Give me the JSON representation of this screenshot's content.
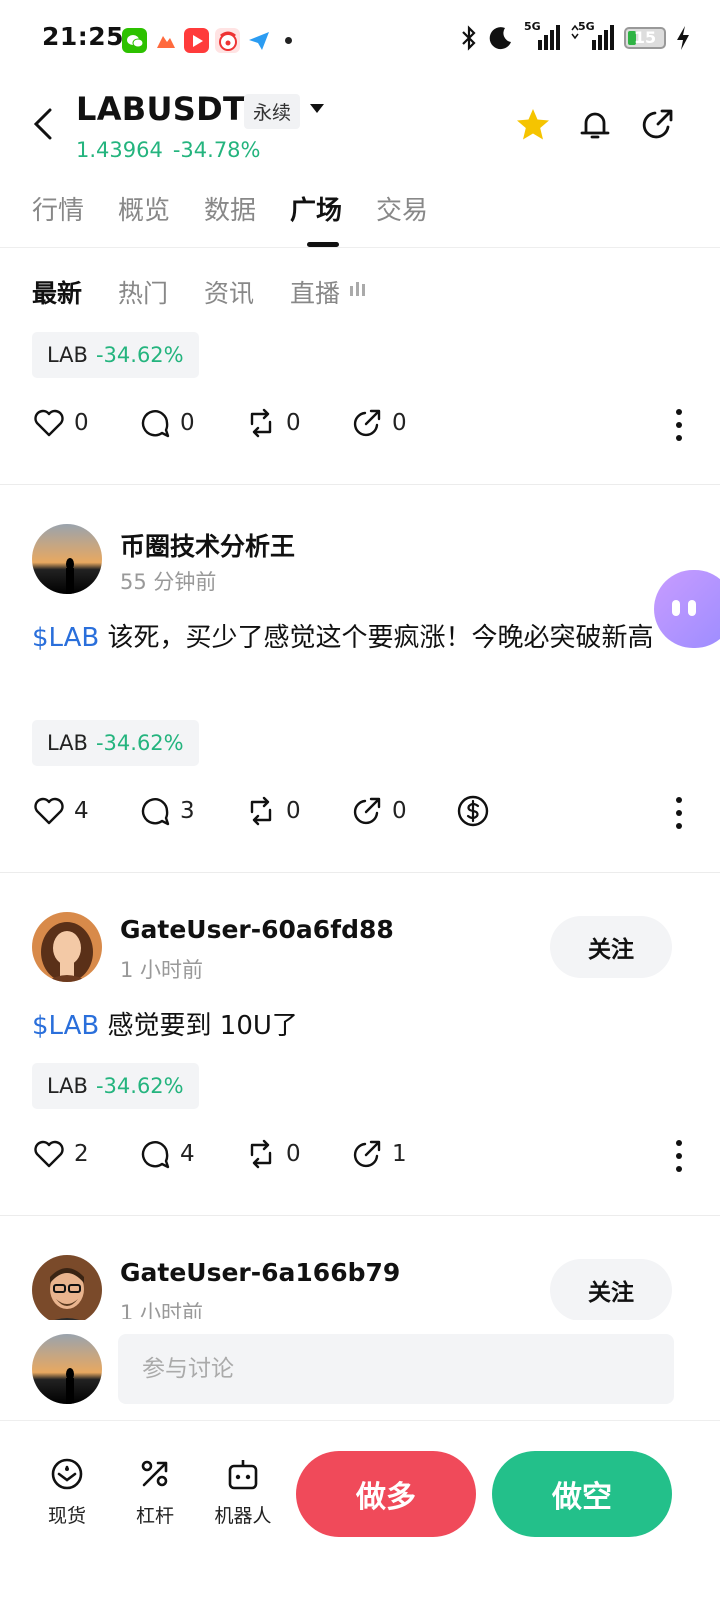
{
  "status_bar": {
    "time": "21:25",
    "battery": "15",
    "signal_1": "5G",
    "signal_2": "5G"
  },
  "header": {
    "pair": "LABUSDT",
    "contract_type": "永续",
    "price": "1.43964",
    "change": "-34.78%",
    "icons": [
      "back-arrow-icon",
      "star-icon",
      "bell-icon",
      "share-icon"
    ],
    "colors": {
      "up_green": "#24b47e",
      "star": "#f5c400"
    }
  },
  "tabs": [
    {
      "label": "行情"
    },
    {
      "label": "概览"
    },
    {
      "label": "数据"
    },
    {
      "label": "广场"
    },
    {
      "label": "交易"
    }
  ],
  "active_tab": "广场",
  "subtabs": [
    {
      "label": "最新"
    },
    {
      "label": "热门"
    },
    {
      "label": "资讯"
    },
    {
      "label": "直播"
    }
  ],
  "active_subtab": "最新",
  "posts": [
    {
      "tag": {
        "symbol": "LAB",
        "change": "-34.62%"
      },
      "likes": "0",
      "comments": "0",
      "reposts": "0",
      "shares": "0"
    },
    {
      "author": "币圈技术分析王",
      "time": "55 分钟前",
      "cashtag": "$LAB",
      "text": "该死，买少了感觉这个要疯涨！今晚必突破新高",
      "tag": {
        "symbol": "LAB",
        "change": "-34.62%"
      },
      "likes": "4",
      "comments": "3",
      "reposts": "0",
      "shares": "0",
      "tip_icon": "dollar-coin-icon"
    },
    {
      "author": "GateUser-60a6fd88",
      "time": "1 小时前",
      "follow_label": "关注",
      "cashtag": "$LAB",
      "text": "感觉要到 10U了",
      "tag": {
        "symbol": "LAB",
        "change": "-34.62%"
      },
      "likes": "2",
      "comments": "4",
      "reposts": "0",
      "shares": "1"
    },
    {
      "author": "GateUser-6a166b79",
      "time": "1 小时前",
      "follow_label": "关注"
    }
  ],
  "comment_bar": {
    "placeholder": "参与讨论"
  },
  "bottom_nav": {
    "items": [
      {
        "label": "现货",
        "icon": "spot-icon"
      },
      {
        "label": "杠杆",
        "icon": "leverage-icon"
      },
      {
        "label": "机器人",
        "icon": "robot-icon"
      }
    ],
    "long_label": "做多",
    "short_label": "做空",
    "colors": {
      "long": "#f04a5a",
      "short": "#23c08a"
    }
  }
}
